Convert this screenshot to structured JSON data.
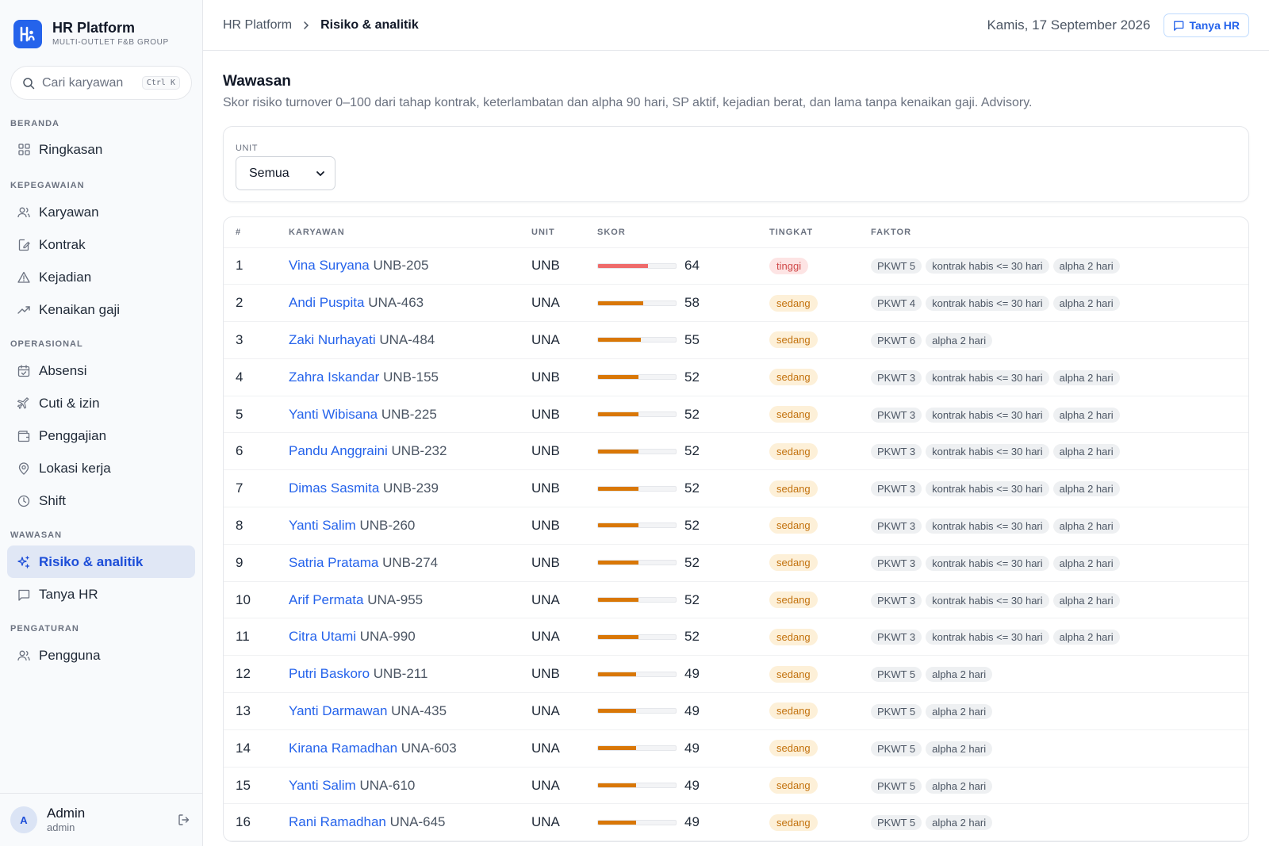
{
  "brand": {
    "name": "HR Platform",
    "subtitle": "MULTI-OUTLET F&B GROUP"
  },
  "search": {
    "placeholder": "Cari karyawan",
    "shortcut": "Ctrl K"
  },
  "nav": {
    "sections": {
      "beranda": "BERANDA",
      "kepegawaian": "KEPEGAWAIAN",
      "operasional": "OPERASIONAL",
      "wawasan": "WAWASAN",
      "pengaturan": "PENGATURAN"
    },
    "items": {
      "ringkasan": "Ringkasan",
      "karyawan": "Karyawan",
      "kontrak": "Kontrak",
      "kejadian": "Kejadian",
      "kenaikan_gaji": "Kenaikan gaji",
      "absensi": "Absensi",
      "cuti": "Cuti & izin",
      "penggajian": "Penggajian",
      "lokasi": "Lokasi kerja",
      "shift": "Shift",
      "risiko": "Risiko & analitik",
      "tanya_hr": "Tanya HR",
      "pengguna": "Pengguna"
    },
    "active": "risiko"
  },
  "user": {
    "initial": "A",
    "name": "Admin",
    "role": "admin"
  },
  "topbar": {
    "breadcrumb_root": "HR Platform",
    "breadcrumb_current": "Risiko & analitik",
    "date": "Kamis, 17 September 2026",
    "ask_button": "Tanya HR"
  },
  "page": {
    "title": "Wawasan",
    "description": "Skor risiko turnover 0–100 dari tahap kontrak, keterlambatan dan alpha 90 hari, SP aktif, kejadian berat, dan lama tanpa kenaikan gaji. Advisory."
  },
  "filter": {
    "label": "UNIT",
    "value": "Semua"
  },
  "table": {
    "headers": {
      "no": "#",
      "employee": "KARYAWAN",
      "unit": "UNIT",
      "score": "SKOR",
      "level": "TINGKAT",
      "factors": "FAKTOR"
    },
    "rows": [
      {
        "no": "1",
        "name": "Vina Suryana",
        "code": "UNB-205",
        "unit": "UNB",
        "score": 64,
        "level": "tinggi",
        "factors": [
          "PKWT 5",
          "kontrak habis <= 30 hari",
          "alpha 2 hari"
        ]
      },
      {
        "no": "2",
        "name": "Andi Puspita",
        "code": "UNA-463",
        "unit": "UNA",
        "score": 58,
        "level": "sedang",
        "factors": [
          "PKWT 4",
          "kontrak habis <= 30 hari",
          "alpha 2 hari"
        ]
      },
      {
        "no": "3",
        "name": "Zaki Nurhayati",
        "code": "UNA-484",
        "unit": "UNA",
        "score": 55,
        "level": "sedang",
        "factors": [
          "PKWT 6",
          "alpha 2 hari"
        ]
      },
      {
        "no": "4",
        "name": "Zahra Iskandar",
        "code": "UNB-155",
        "unit": "UNB",
        "score": 52,
        "level": "sedang",
        "factors": [
          "PKWT 3",
          "kontrak habis <= 30 hari",
          "alpha 2 hari"
        ]
      },
      {
        "no": "5",
        "name": "Yanti Wibisana",
        "code": "UNB-225",
        "unit": "UNB",
        "score": 52,
        "level": "sedang",
        "factors": [
          "PKWT 3",
          "kontrak habis <= 30 hari",
          "alpha 2 hari"
        ]
      },
      {
        "no": "6",
        "name": "Pandu Anggraini",
        "code": "UNB-232",
        "unit": "UNB",
        "score": 52,
        "level": "sedang",
        "factors": [
          "PKWT 3",
          "kontrak habis <= 30 hari",
          "alpha 2 hari"
        ]
      },
      {
        "no": "7",
        "name": "Dimas Sasmita",
        "code": "UNB-239",
        "unit": "UNB",
        "score": 52,
        "level": "sedang",
        "factors": [
          "PKWT 3",
          "kontrak habis <= 30 hari",
          "alpha 2 hari"
        ]
      },
      {
        "no": "8",
        "name": "Yanti Salim",
        "code": "UNB-260",
        "unit": "UNB",
        "score": 52,
        "level": "sedang",
        "factors": [
          "PKWT 3",
          "kontrak habis <= 30 hari",
          "alpha 2 hari"
        ]
      },
      {
        "no": "9",
        "name": "Satria Pratama",
        "code": "UNB-274",
        "unit": "UNB",
        "score": 52,
        "level": "sedang",
        "factors": [
          "PKWT 3",
          "kontrak habis <= 30 hari",
          "alpha 2 hari"
        ]
      },
      {
        "no": "10",
        "name": "Arif Permata",
        "code": "UNA-955",
        "unit": "UNA",
        "score": 52,
        "level": "sedang",
        "factors": [
          "PKWT 3",
          "kontrak habis <= 30 hari",
          "alpha 2 hari"
        ]
      },
      {
        "no": "11",
        "name": "Citra Utami",
        "code": "UNA-990",
        "unit": "UNA",
        "score": 52,
        "level": "sedang",
        "factors": [
          "PKWT 3",
          "kontrak habis <= 30 hari",
          "alpha 2 hari"
        ]
      },
      {
        "no": "12",
        "name": "Putri Baskoro",
        "code": "UNB-211",
        "unit": "UNB",
        "score": 49,
        "level": "sedang",
        "factors": [
          "PKWT 5",
          "alpha 2 hari"
        ]
      },
      {
        "no": "13",
        "name": "Yanti Darmawan",
        "code": "UNA-435",
        "unit": "UNA",
        "score": 49,
        "level": "sedang",
        "factors": [
          "PKWT 5",
          "alpha 2 hari"
        ]
      },
      {
        "no": "14",
        "name": "Kirana Ramadhan",
        "code": "UNA-603",
        "unit": "UNA",
        "score": 49,
        "level": "sedang",
        "factors": [
          "PKWT 5",
          "alpha 2 hari"
        ]
      },
      {
        "no": "15",
        "name": "Yanti Salim",
        "code": "UNA-610",
        "unit": "UNA",
        "score": 49,
        "level": "sedang",
        "factors": [
          "PKWT 5",
          "alpha 2 hari"
        ]
      },
      {
        "no": "16",
        "name": "Rani Ramadhan",
        "code": "UNA-645",
        "unit": "UNA",
        "score": 49,
        "level": "sedang",
        "factors": [
          "PKWT 5",
          "alpha 2 hari"
        ]
      }
    ]
  },
  "colors": {
    "accent": "#2563eb",
    "high": "#ef6b6b",
    "medium": "#d97706"
  }
}
